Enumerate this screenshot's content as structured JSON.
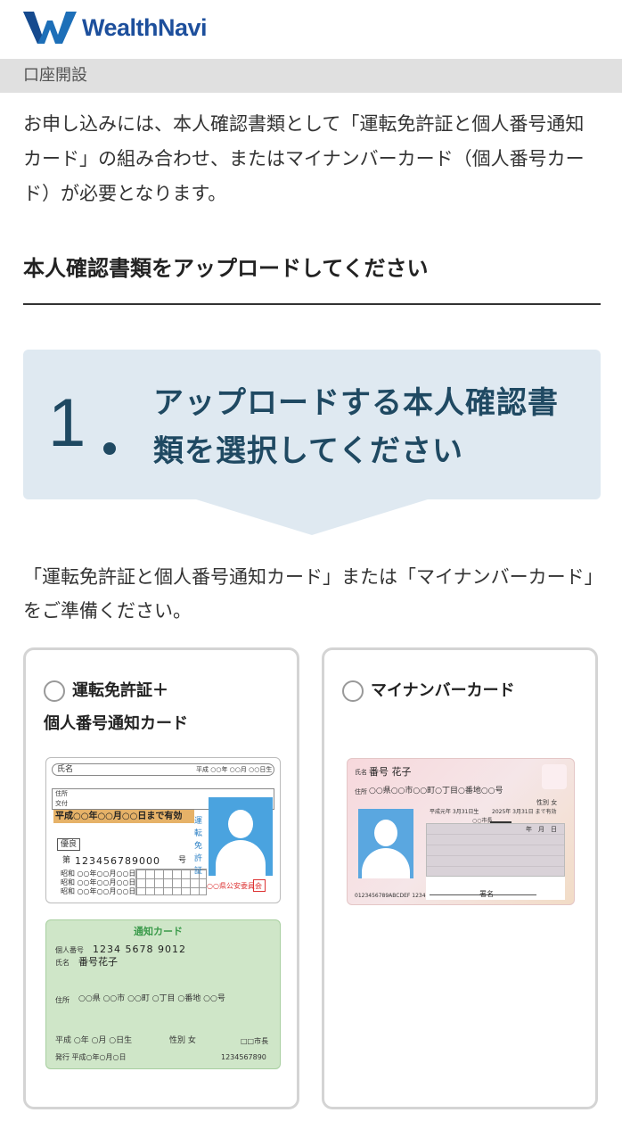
{
  "header": {
    "brand": "WealthNavi"
  },
  "section": {
    "title": "口座開設"
  },
  "intro": {
    "text": "お申し込みには、本人確認書類として「運転免許証と個人番号通知カード」の組み合わせ、またはマイナンバーカード（個人番号カード）が必要となります。"
  },
  "upload": {
    "title": "本人確認書類をアップロードしてください"
  },
  "step": {
    "number": "1",
    "text": "アップロードする本人確認書類を選択してください"
  },
  "prep": {
    "text": "「運転免許証と個人番号通知カード」または「マイナンバーカード」をご準備ください。"
  },
  "options": [
    {
      "label_line1": "運転免許証＋",
      "label_line2": "個人番号通知カード",
      "license": {
        "name_label": "氏名",
        "date_header": "平成 ○○年 ○○月 ○○日生",
        "address_label": "住所",
        "issue_label": "交付",
        "expiry": "平成○○年○○月○○日まで有効",
        "condition": "優良",
        "number_label": "第",
        "number": "123456789000",
        "number_suffix": "号",
        "history_1": "昭和 ○○年○○月○○日",
        "history_2": "昭和 ○○年○○月○○日",
        "history_3": "昭和 ○○年○○月○○日",
        "side_text": "運転免許証",
        "authority": "○○県公安委員会"
      },
      "notification": {
        "title": "通知カード",
        "number_label": "個人番号",
        "number": "1234 5678 9012",
        "name_label": "氏名",
        "name": "番号花子",
        "address_label": "住所",
        "address": "○○県 ○○市 ○○町 ○丁目 ○番地 ○○号",
        "birth": "平成 ○年 ○月 ○日生",
        "gender": "性別 女",
        "city": "□□市長",
        "issued": "発行 平成○年○月○日",
        "serial": "1234567890"
      }
    },
    {
      "label": "マイナンバーカード",
      "mynumber": {
        "name_label": "氏名",
        "name": "番号 花子",
        "address_label": "住所",
        "address": "○○県○○市○○町○丁目○番地○○号",
        "gender": "性別 女",
        "birth": "平成元年 3月31日生",
        "expiry": "2025年 3月31日 まで有効",
        "city": "○○市長",
        "date_cols": "年　月　日",
        "serial": "0123456789ABCDEF 1234",
        "signature": "署名"
      }
    }
  ],
  "colors": {
    "brand": "#1d4f9c",
    "step_bg": "#dfe9f1",
    "step_text": "#1f4962",
    "border": "#d4d4d4"
  }
}
